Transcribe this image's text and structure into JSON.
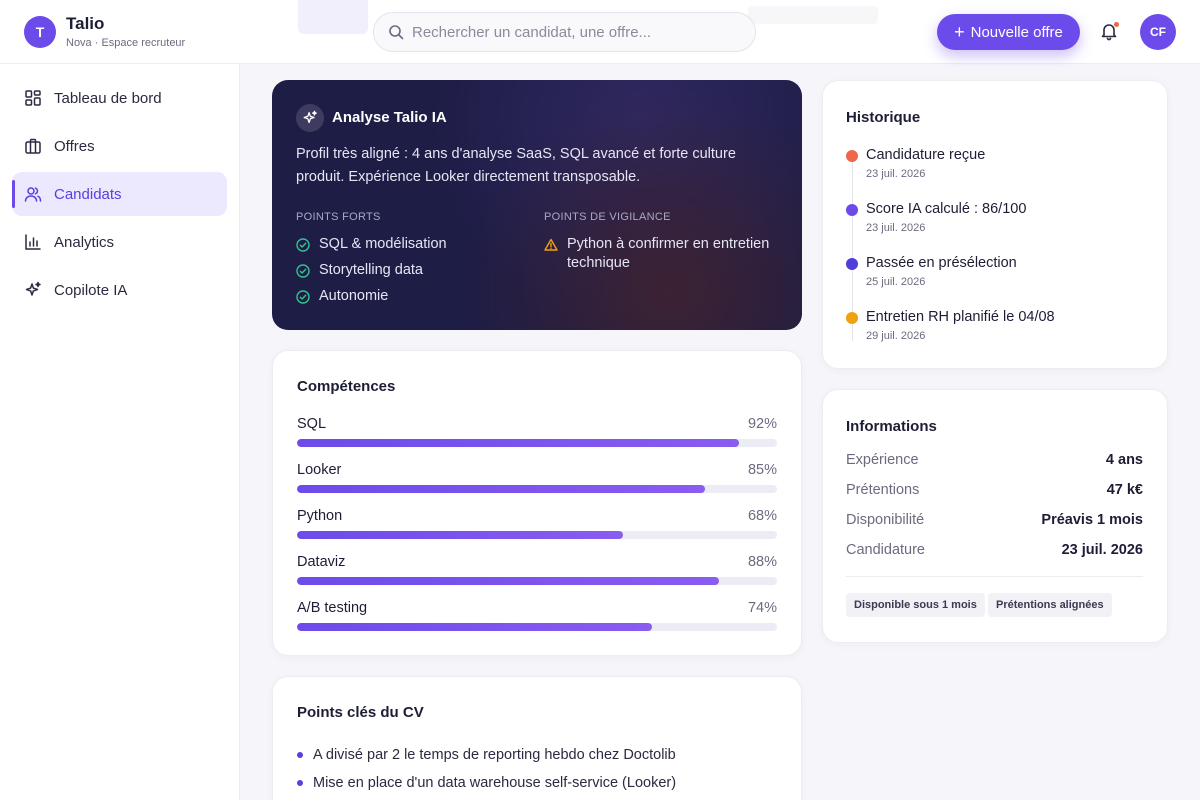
{
  "app": {
    "logo_letter": "T",
    "name": "Talio",
    "subtitle": "Nova · Espace recruteur"
  },
  "header": {
    "search_placeholder": "Rechercher un candidat, une offre...",
    "new_offer_label": "Nouvelle offre",
    "avatar_initials": "CF"
  },
  "sidebar": {
    "items": [
      {
        "label": "Tableau de bord",
        "icon": "dashboard-icon"
      },
      {
        "label": "Offres",
        "icon": "briefcase-icon"
      },
      {
        "label": "Candidats",
        "icon": "users-icon",
        "active": true
      },
      {
        "label": "Analytics",
        "icon": "bar-chart-icon"
      },
      {
        "label": "Copilote IA",
        "icon": "sparkles-icon"
      }
    ]
  },
  "ai_analysis": {
    "title": "Analyse Talio IA",
    "summary": "Profil très aligné : 4 ans d'analyse SaaS, SQL avancé et forte culture produit. Expérience Looker directement transposable.",
    "strengths_title": "POINTS FORTS",
    "strengths": [
      "SQL & modélisation",
      "Storytelling data",
      "Autonomie"
    ],
    "concerns_title": "POINTS DE VIGILANCE",
    "concerns": [
      "Python à confirmer en entretien technique"
    ]
  },
  "skills": {
    "title": "Compétences",
    "items": [
      {
        "name": "SQL",
        "value": 92,
        "label": "92%"
      },
      {
        "name": "Looker",
        "value": 85,
        "label": "85%"
      },
      {
        "name": "Python",
        "value": 68,
        "label": "68%"
      },
      {
        "name": "Dataviz",
        "value": 88,
        "label": "88%"
      },
      {
        "name": "A/B testing",
        "value": 74,
        "label": "74%"
      }
    ]
  },
  "cv_highlights": {
    "title": "Points clés du CV",
    "items": [
      "A divisé par 2 le temps de reporting hebdo chez Doctolib",
      "Mise en place d'un data warehouse self-service (Looker)"
    ]
  },
  "history": {
    "title": "Historique",
    "events": [
      {
        "label": "Candidature reçue",
        "date": "23 juil. 2026",
        "color": "#f0664a"
      },
      {
        "label": "Score IA calculé : 86/100",
        "date": "23 juil. 2026",
        "color": "#6c4bea"
      },
      {
        "label": "Passée en présélection",
        "date": "25 juil. 2026",
        "color": "#4f3ed8"
      },
      {
        "label": "Entretien RH planifié le 04/08",
        "date": "29 juil. 2026",
        "color": "#f0a10f"
      }
    ]
  },
  "information": {
    "title": "Informations",
    "rows": [
      {
        "key": "Expérience",
        "value": "4 ans"
      },
      {
        "key": "Prétentions",
        "value": "47 k€"
      },
      {
        "key": "Disponibilité",
        "value": "Préavis 1 mois"
      },
      {
        "key": "Candidature",
        "value": "23 juil. 2026"
      }
    ],
    "tags": [
      "Disponible sous 1 mois",
      "Prétentions alignées"
    ]
  },
  "colors": {
    "accent": "#6c4bea",
    "ai_card_bg": "#1e1d46",
    "strength_icon": "#34c38f",
    "warning_icon": "#f0a10f"
  }
}
